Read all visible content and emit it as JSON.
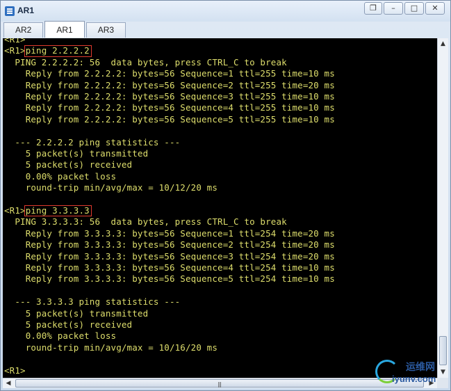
{
  "window": {
    "title": "AR1",
    "controls": {
      "restore": "❐",
      "minimize": "–",
      "maximize": "□",
      "close": "✕"
    }
  },
  "tabs": [
    {
      "label": "AR2",
      "active": false
    },
    {
      "label": "AR1",
      "active": true
    },
    {
      "label": "AR3",
      "active": false
    }
  ],
  "terminal": {
    "lines": [
      "<R1>",
      "<R1>ping 2.2.2.2",
      "  PING 2.2.2.2: 56  data bytes, press CTRL_C to break",
      "    Reply from 2.2.2.2: bytes=56 Sequence=1 ttl=255 time=10 ms",
      "    Reply from 2.2.2.2: bytes=56 Sequence=2 ttl=255 time=20 ms",
      "    Reply from 2.2.2.2: bytes=56 Sequence=3 ttl=255 time=10 ms",
      "    Reply from 2.2.2.2: bytes=56 Sequence=4 ttl=255 time=10 ms",
      "    Reply from 2.2.2.2: bytes=56 Sequence=5 ttl=255 time=10 ms",
      "",
      "  --- 2.2.2.2 ping statistics ---",
      "    5 packet(s) transmitted",
      "    5 packet(s) received",
      "    0.00% packet loss",
      "    round-trip min/avg/max = 10/12/20 ms",
      "",
      "<R1>ping 3.3.3.3",
      "  PING 3.3.3.3: 56  data bytes, press CTRL_C to break",
      "    Reply from 3.3.3.3: bytes=56 Sequence=1 ttl=254 time=20 ms",
      "    Reply from 3.3.3.3: bytes=56 Sequence=2 ttl=254 time=20 ms",
      "    Reply from 3.3.3.3: bytes=56 Sequence=3 ttl=254 time=20 ms",
      "    Reply from 3.3.3.3: bytes=56 Sequence=4 ttl=254 time=10 ms",
      "    Reply from 3.3.3.3: bytes=56 Sequence=5 ttl=254 time=10 ms",
      "",
      "  --- 3.3.3.3 ping statistics ---",
      "    5 packet(s) transmitted",
      "    5 packet(s) received",
      "    0.00% packet loss",
      "    round-trip min/avg/max = 10/16/20 ms",
      "",
      "<R1>"
    ],
    "highlighted_commands": [
      "ping 2.2.2.2",
      "ping 3.3.3.3"
    ],
    "text_color": "#dede6c",
    "background_color": "#000000",
    "highlight_color": "#e03a2e"
  },
  "scrollbars": {
    "up_arrow": "▲",
    "down_arrow": "▼",
    "left_arrow": "◀",
    "right_arrow": "▶",
    "grip": "|||"
  },
  "watermark": {
    "cn_text": "运维网",
    "en_text": "iyunv.com"
  }
}
